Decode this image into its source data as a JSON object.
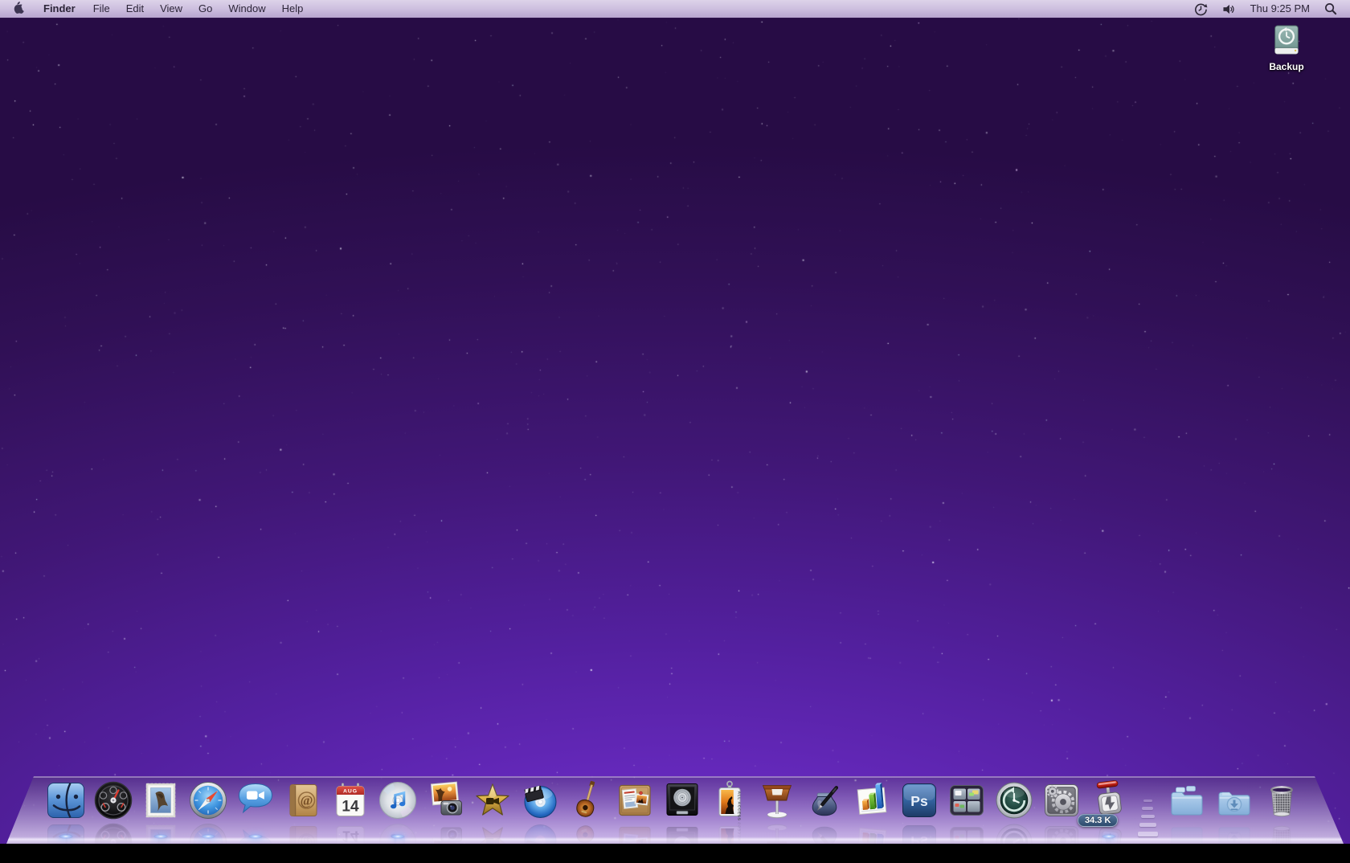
{
  "menu_bar": {
    "apple_menu": {
      "icon": "apple-logo-icon"
    },
    "menus": [
      {
        "label": "Finder",
        "bold": true
      },
      {
        "label": "File"
      },
      {
        "label": "Edit"
      },
      {
        "label": "View"
      },
      {
        "label": "Go"
      },
      {
        "label": "Window"
      },
      {
        "label": "Help"
      }
    ],
    "status": {
      "icons": [
        {
          "name": "time-machine-menu-icon"
        },
        {
          "name": "volume-menu-icon"
        }
      ],
      "clock": "Thu 9:25 PM",
      "spotlight": {
        "name": "spotlight-menu-icon"
      }
    }
  },
  "desktop": {
    "icons": [
      {
        "id": "backup",
        "label": "Backup",
        "glyph": "time-machine-drive-icon"
      }
    ],
    "wallpaper": {
      "top": "#2a0d49",
      "mid": "#451979",
      "glow": "#7b38d9"
    }
  },
  "dock": {
    "apps": [
      {
        "id": "finder",
        "name": "finder-icon",
        "running": true
      },
      {
        "id": "dashboard",
        "name": "dashboard-icon",
        "running": false
      },
      {
        "id": "mail",
        "name": "mail-icon",
        "running": true
      },
      {
        "id": "safari",
        "name": "safari-icon",
        "running": true
      },
      {
        "id": "ichat",
        "name": "ichat-icon",
        "running": true
      },
      {
        "id": "addressbook",
        "name": "address-book-icon",
        "running": false,
        "glyph": "@"
      },
      {
        "id": "ical",
        "name": "ical-icon",
        "running": false,
        "month": "AUG",
        "day": "14"
      },
      {
        "id": "itunes",
        "name": "itunes-icon",
        "running": true
      },
      {
        "id": "iphoto",
        "name": "iphoto-icon",
        "running": false
      },
      {
        "id": "imovie",
        "name": "imovie-icon",
        "running": false
      },
      {
        "id": "idvd",
        "name": "idvd-icon",
        "running": false
      },
      {
        "id": "garageband",
        "name": "garageband-icon",
        "running": false
      },
      {
        "id": "iweb",
        "name": "iweb-icon",
        "running": false
      },
      {
        "id": "logicstudio",
        "name": "logic-studio-record-icon",
        "running": false
      },
      {
        "id": "allaccess",
        "name": "logic-pro-pass-icon",
        "running": false,
        "text": "ALL ACCESS"
      },
      {
        "id": "keynote",
        "name": "keynote-icon",
        "running": false
      },
      {
        "id": "pages",
        "name": "pages-icon",
        "running": false
      },
      {
        "id": "numbers",
        "name": "numbers-icon",
        "running": false
      },
      {
        "id": "photoshop",
        "name": "photoshop-icon",
        "running": false,
        "text": "Ps"
      },
      {
        "id": "spaces",
        "name": "spaces-icon",
        "running": false
      },
      {
        "id": "timemachine",
        "name": "time-machine-icon",
        "running": false
      },
      {
        "id": "sysprefs",
        "name": "system-preferences-icon",
        "running": false
      },
      {
        "id": "speeddownload",
        "name": "speed-download-icon",
        "running": true,
        "badge": "34.3 K"
      }
    ],
    "others": [
      {
        "id": "folderdocs",
        "name": "documents-stack-icon",
        "running": false
      },
      {
        "id": "folderdl",
        "name": "downloads-folder-icon",
        "running": false
      },
      {
        "id": "trash",
        "name": "trash-icon",
        "running": false
      }
    ]
  }
}
